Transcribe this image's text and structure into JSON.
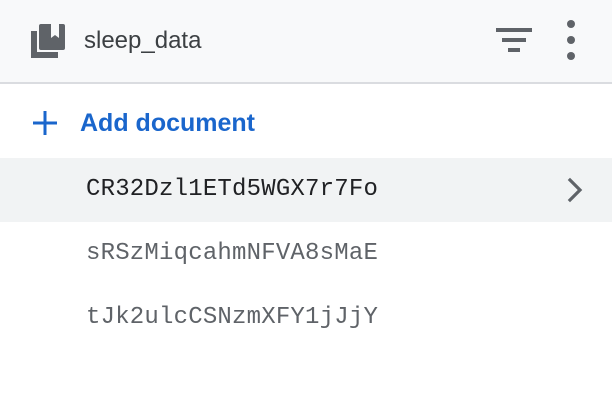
{
  "header": {
    "collection_name": "sleep_data",
    "icons": {
      "collection": "collection-icon",
      "filter": "filter-icon",
      "more": "more-vert-icon"
    }
  },
  "actions": {
    "add_document_label": "Add document",
    "add_icon": "plus-icon"
  },
  "documents": [
    {
      "id": "CR32Dzl1ETd5WGX7r7Fo",
      "selected": true
    },
    {
      "id": "sRSzMiqcahmNFVA8sMaE",
      "selected": false
    },
    {
      "id": "tJk2ulcCSNzmXFY1jJjY",
      "selected": false
    }
  ],
  "colors": {
    "accent": "#1a66cc",
    "header_bg": "#f8f9fa",
    "selected_row_bg": "#f1f3f4",
    "icon_gray": "#5f6368"
  }
}
